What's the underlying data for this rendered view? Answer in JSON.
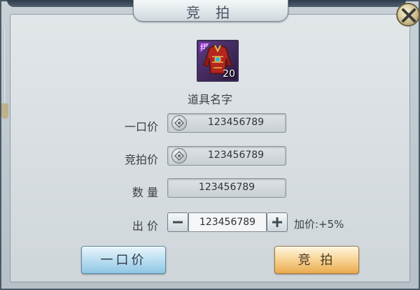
{
  "dialog": {
    "title": "竞 拍",
    "close_icon": "close-icon"
  },
  "item": {
    "icon": "red-armor-icon",
    "bind_tag": "绑",
    "count": "20",
    "name": "道具名字"
  },
  "rows": {
    "buyout": {
      "label": "一口价",
      "value": "123456789",
      "icon": "silver-coin-icon"
    },
    "bid": {
      "label": "竞拍价",
      "value": "123456789",
      "icon": "silver-coin-icon"
    },
    "quantity": {
      "label": "数 量",
      "value": "123456789"
    },
    "offer": {
      "label": "出 价",
      "value": "123456789",
      "markup": "加价:+5%"
    }
  },
  "buttons": {
    "buyout": "一口价",
    "bid": "竞 拍"
  },
  "colors": {
    "buyout_button": "#bfe1f2",
    "bid_button": "#f8d79a",
    "bind_tag": "#8e2ac9"
  }
}
